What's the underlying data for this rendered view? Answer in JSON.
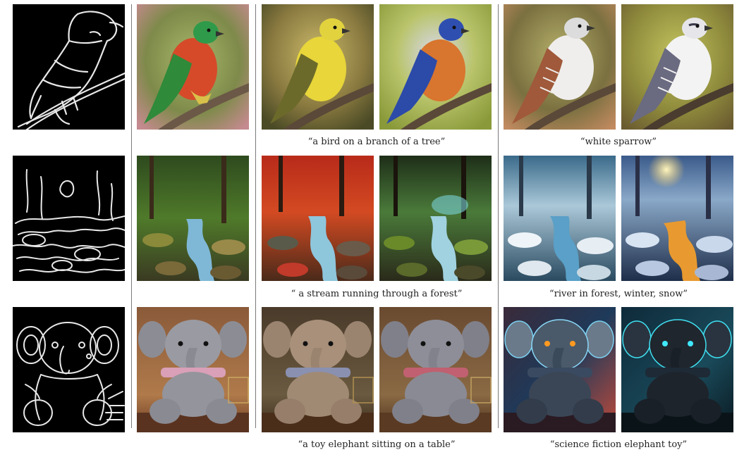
{
  "captions": {
    "row1_prompt": "“a bird on a branch of a tree”",
    "row1_edit": "“white sparrow”",
    "row2_prompt": "“ a stream running through a forest”",
    "row2_edit": "“river in forest, winter, snow”",
    "row3_prompt": "“a toy elephant sitting on a table”",
    "row3_edit": "“science fiction elephant toy”"
  },
  "colors": {
    "edge_bg": "#000000",
    "edge_line": "#e8e8e8",
    "divider": "#7a7a7a",
    "caption_text": "#1f1f1f"
  }
}
